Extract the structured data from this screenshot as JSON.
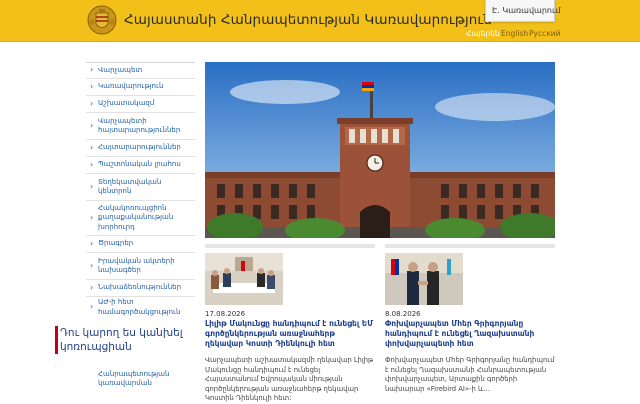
{
  "header": {
    "title": "Հայաստանի Հանրապետության Կառավարություն",
    "login_label": "Է․ Կառավարում",
    "languages": [
      "Հայերեն",
      "English",
      "Русский"
    ],
    "active_language": "Հայերեն"
  },
  "sidebar": {
    "items": [
      "Վարչապետ",
      "Կառավարություն",
      "Աշխատակազմ",
      "Վարչապետի հայտարարություններ",
      "Հայտարարություններ",
      "Պաշտոնական լրահոս",
      "Տեղեկատվական կենտրոն",
      "Հակակոռուպցիոն քաղաքականության խորհուրդ",
      "Ծրագրեր",
      "Իրավական ակտերի նախագծեր",
      "Նախաձեռնություններ",
      "ԱԺ-ի հետ համագործակցություն"
    ],
    "cta_text": "Դու կարող ես կանխել կոռուպցիան",
    "tail_text": "Հանրապետության կառավարման"
  },
  "news": [
    {
      "date": "17.08.2026",
      "title": "Լիլիթ Մակունցը հանդիպում է ունեցել ԵՄ գործընկերության առաջնահերթ ղեկավար Կոստի Դիենկուլի հետ",
      "body": "Վարչապետի աշխատակազմի ղեկավար Լիլիթ Մակունցը հանդիպում է ունեցել Հայաստանում Եվրոպական միության գործընկերության առաջնահերթ ղեկավար Կոստին Դիենկուլի հետ:"
    },
    {
      "date": "8.08.2026",
      "title": "Փոխվարչապետ Մհեր Գրիգորյանը հանդիպում է ունեցել Ղազախստանի փոխվարչապետի հետ",
      "body": "Փոխվարչապետ Մհեր Գրիգորյանը հանդիպում է ունեցել Ղազախստանի Հանրապետության փոխվարչապետ, Արտաքին գործերի նախարար «Firebird AI»-ի և..."
    }
  ],
  "colors": {
    "header": "#f3c01a",
    "link": "#1f5fa8",
    "accent": "#c0001a"
  }
}
